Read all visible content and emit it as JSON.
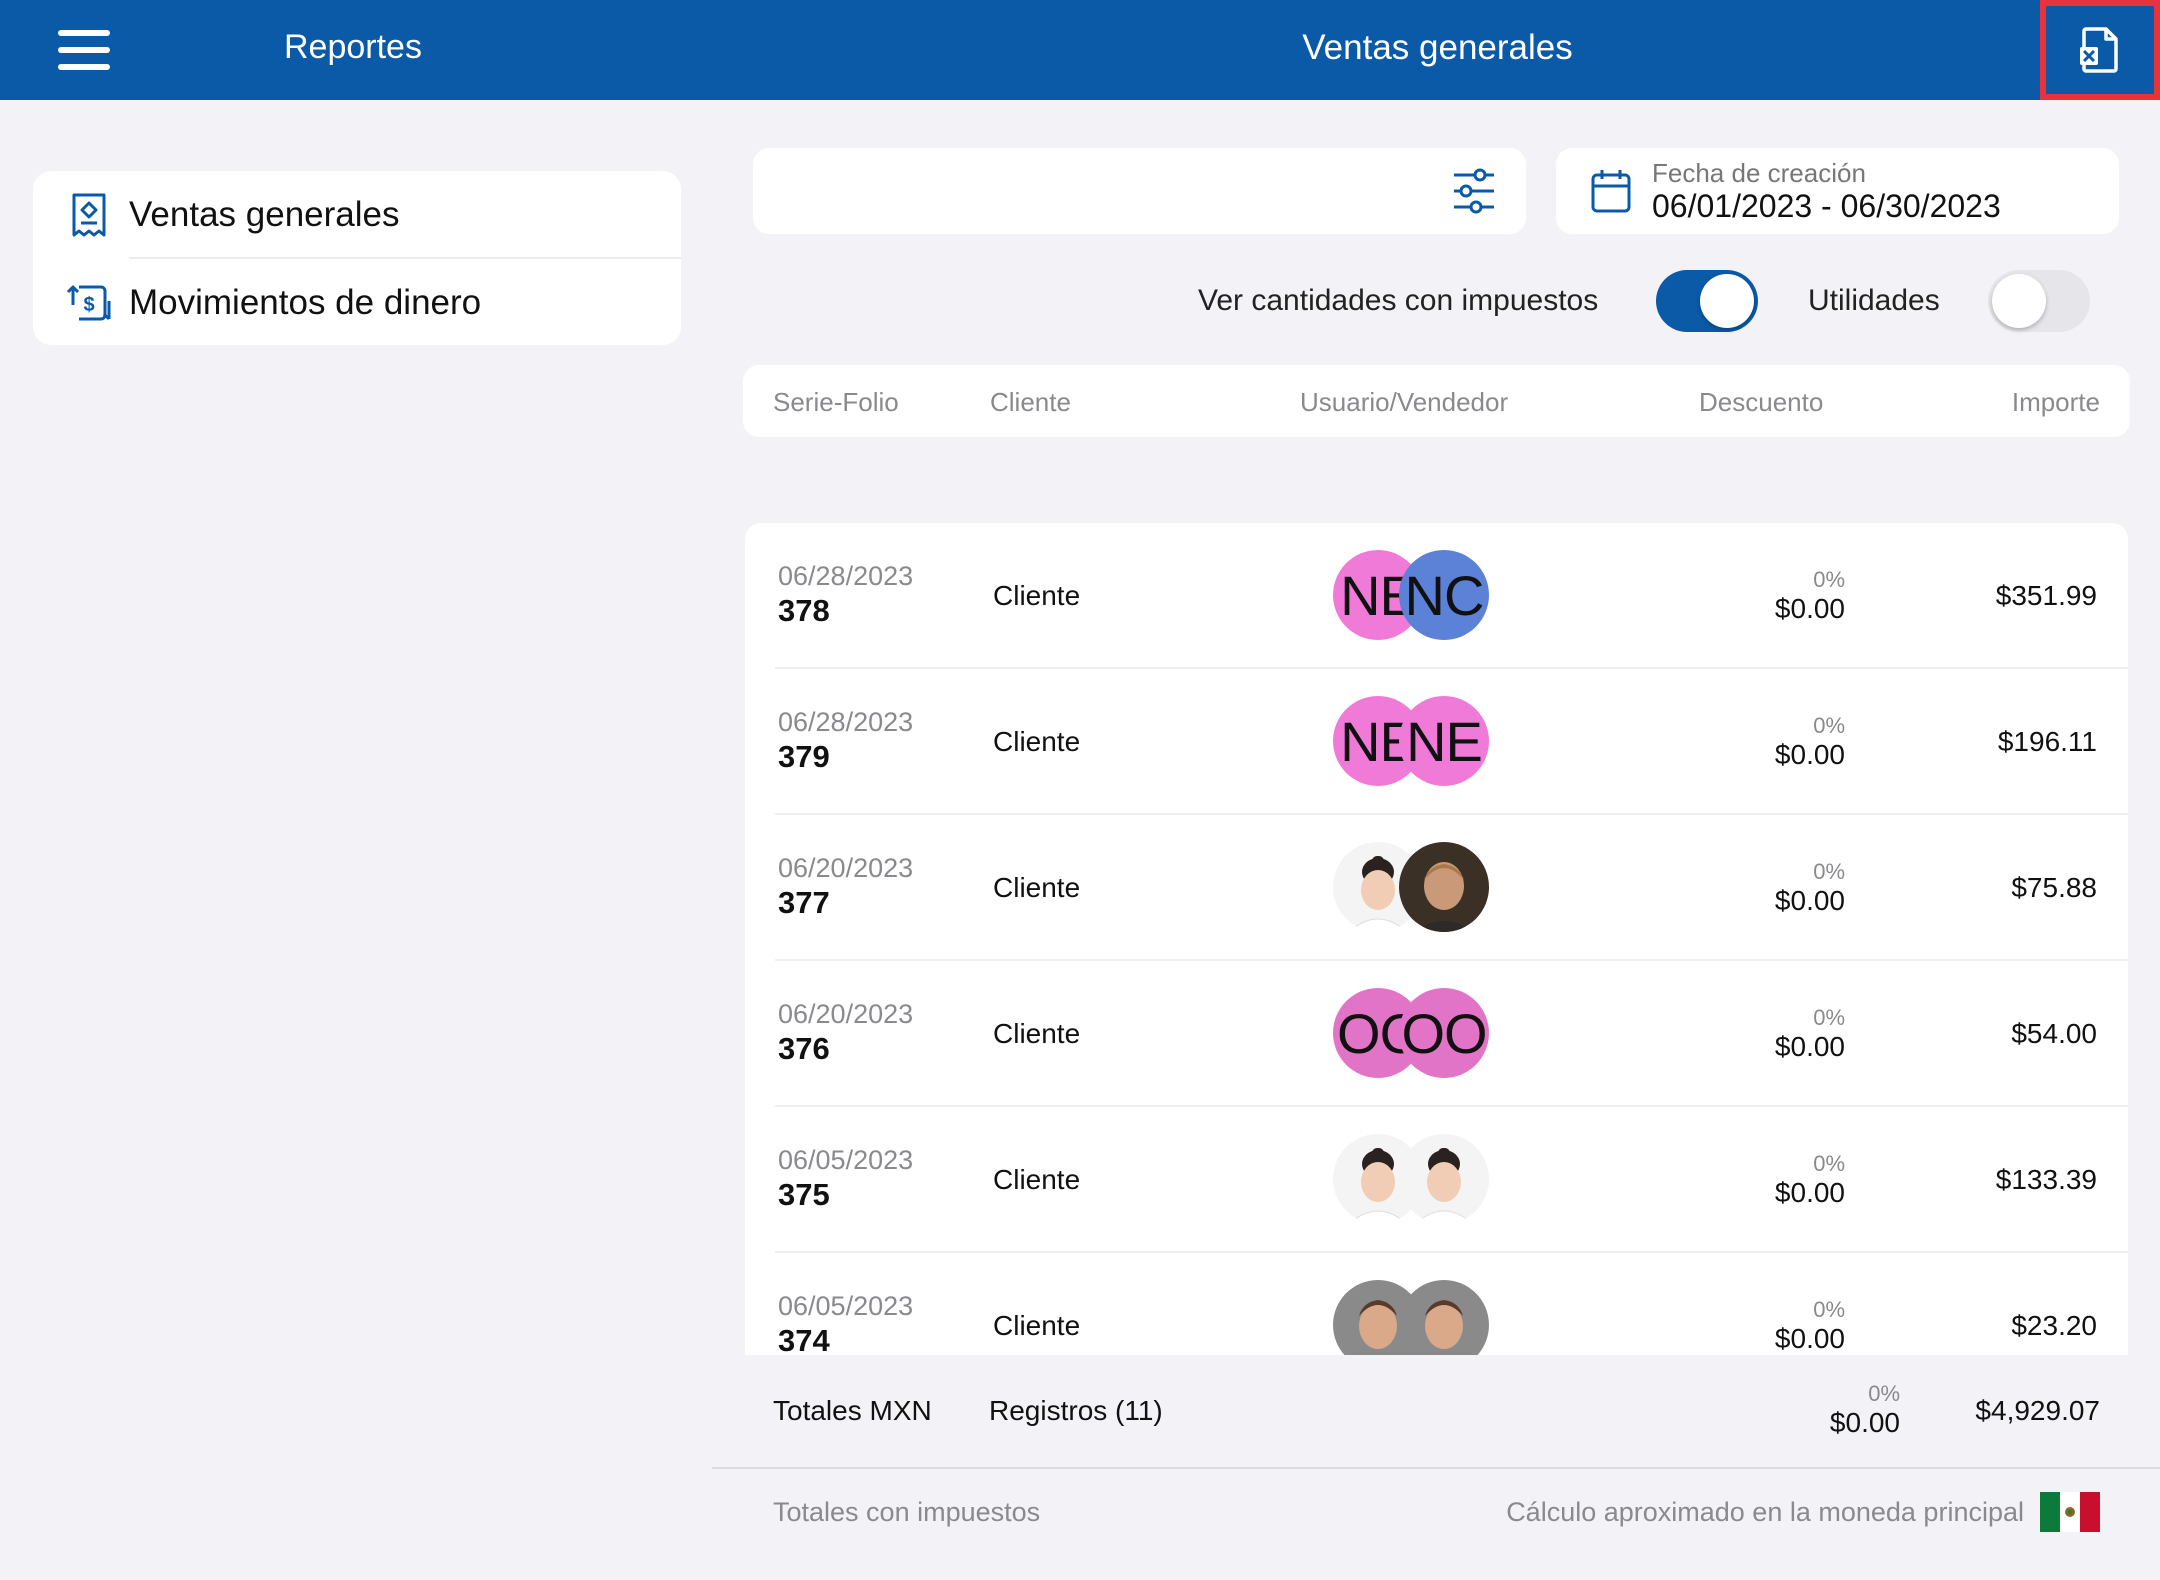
{
  "header": {
    "nav_title": "Reportes",
    "page_title": "Ventas generales",
    "bar_color": "#0a5aa8",
    "export_icon": "excel-export-icon"
  },
  "sidebar": {
    "items": [
      {
        "label": "Ventas generales",
        "icon": "receipt-icon"
      },
      {
        "label": "Movimientos de dinero",
        "icon": "money-exchange-icon"
      }
    ]
  },
  "filters": {
    "search_value": "",
    "date_label": "Fecha de creación",
    "date_value": "06/01/2023 - 06/30/2023"
  },
  "toggles": {
    "taxes_label": "Ver cantidades con impuestos",
    "taxes_on": true,
    "profits_label": "Utilidades",
    "profits_on": false
  },
  "table": {
    "columns": [
      "Serie-Folio",
      "Cliente",
      "Usuario/Vendedor",
      "Descuento",
      "Importe"
    ],
    "rows": [
      {
        "date": "06/28/2023",
        "folio": "378",
        "client": "Cliente",
        "av1": "NE",
        "av2": "NC",
        "pct": "0%",
        "discount": "$0.00",
        "amount": "$351.99"
      },
      {
        "date": "06/28/2023",
        "folio": "379",
        "client": "Cliente",
        "av1": "NE",
        "av2": "NE",
        "pct": "0%",
        "discount": "$0.00",
        "amount": "$196.11"
      },
      {
        "date": "06/20/2023",
        "folio": "377",
        "client": "Cliente",
        "av1": "",
        "av2": "",
        "pct": "0%",
        "discount": "$0.00",
        "amount": "$75.88"
      },
      {
        "date": "06/20/2023",
        "folio": "376",
        "client": "Cliente",
        "av1": "OC",
        "av2": "OO",
        "pct": "0%",
        "discount": "$0.00",
        "amount": "$54.00"
      },
      {
        "date": "06/05/2023",
        "folio": "375",
        "client": "Cliente",
        "av1": "",
        "av2": "",
        "pct": "0%",
        "discount": "$0.00",
        "amount": "$133.39"
      },
      {
        "date": "06/05/2023",
        "folio": "374",
        "client": "Cliente",
        "av1": "",
        "av2": "",
        "pct": "0%",
        "discount": "$0.00",
        "amount": "$23.20"
      }
    ]
  },
  "totals": {
    "label": "Totales MXN",
    "records": "Registros (11)",
    "pct": "0%",
    "discount": "$0.00",
    "amount": "$4,929.07"
  },
  "footer": {
    "left": "Totales con impuestos",
    "right": "Cálculo aproximado en la moneda principal",
    "flag_icon": "mexico-flag-icon"
  }
}
